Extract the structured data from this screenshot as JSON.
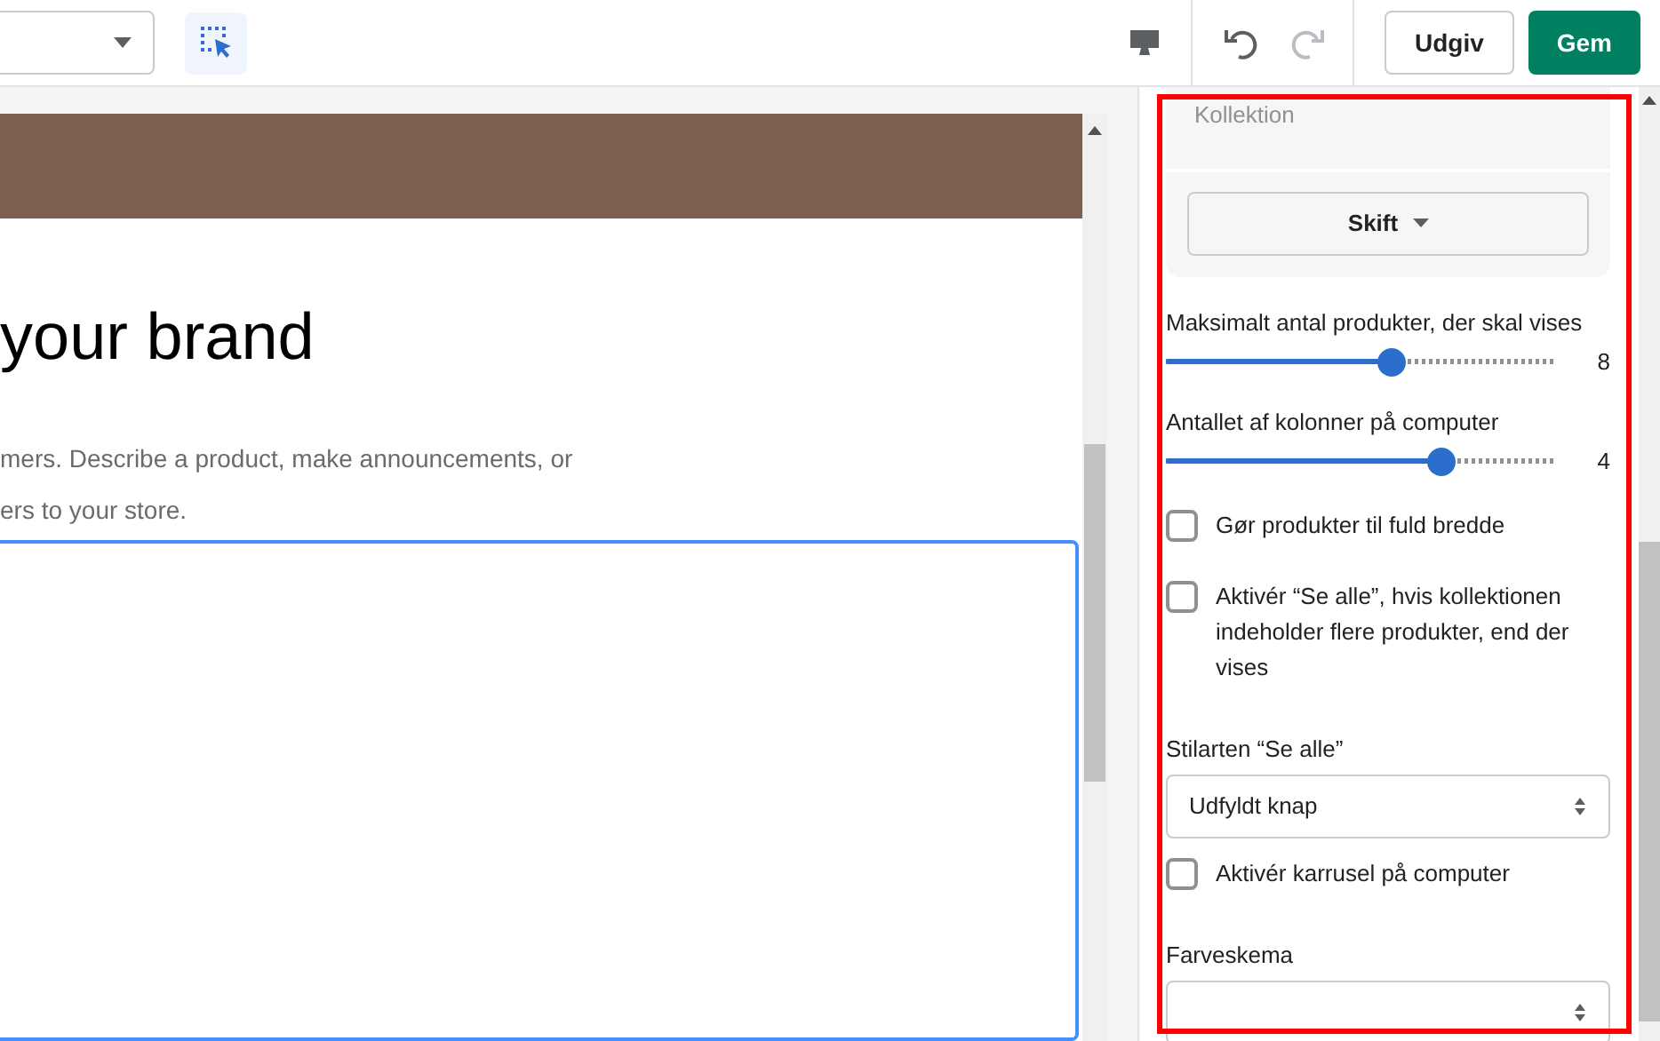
{
  "toolbar": {
    "publish_button": "Udgiv",
    "save_button": "Gem"
  },
  "preview": {
    "heading": "your brand",
    "paragraph_lines": [
      "mers. Describe a product, make announcements, or",
      "ers to your store."
    ]
  },
  "settings": {
    "collection_label": "Kollektion",
    "change_button": "Skift",
    "controls": [
      {
        "kind": "slider",
        "label": "Maksimalt antal produkter, der skal vises",
        "level": 0.59,
        "reading": "8"
      },
      {
        "kind": "slider",
        "label": "Antallet af kolonner på computer",
        "level": 0.73,
        "reading": "4"
      },
      {
        "kind": "checkbox",
        "label": "Gør produkter til fuld bredde",
        "checked": false
      },
      {
        "kind": "checkbox",
        "label": "Aktivér “Se alle”, hvis kollektionen indeholder flere produkter, end der vises",
        "checked": false
      },
      {
        "kind": "select",
        "label": "Stilarten “Se alle”",
        "value": "Udfyldt knap"
      },
      {
        "kind": "checkbox",
        "label": "Aktivér karrusel på computer",
        "checked": false
      },
      {
        "kind": "select",
        "label": "Farveskema"
      }
    ]
  }
}
